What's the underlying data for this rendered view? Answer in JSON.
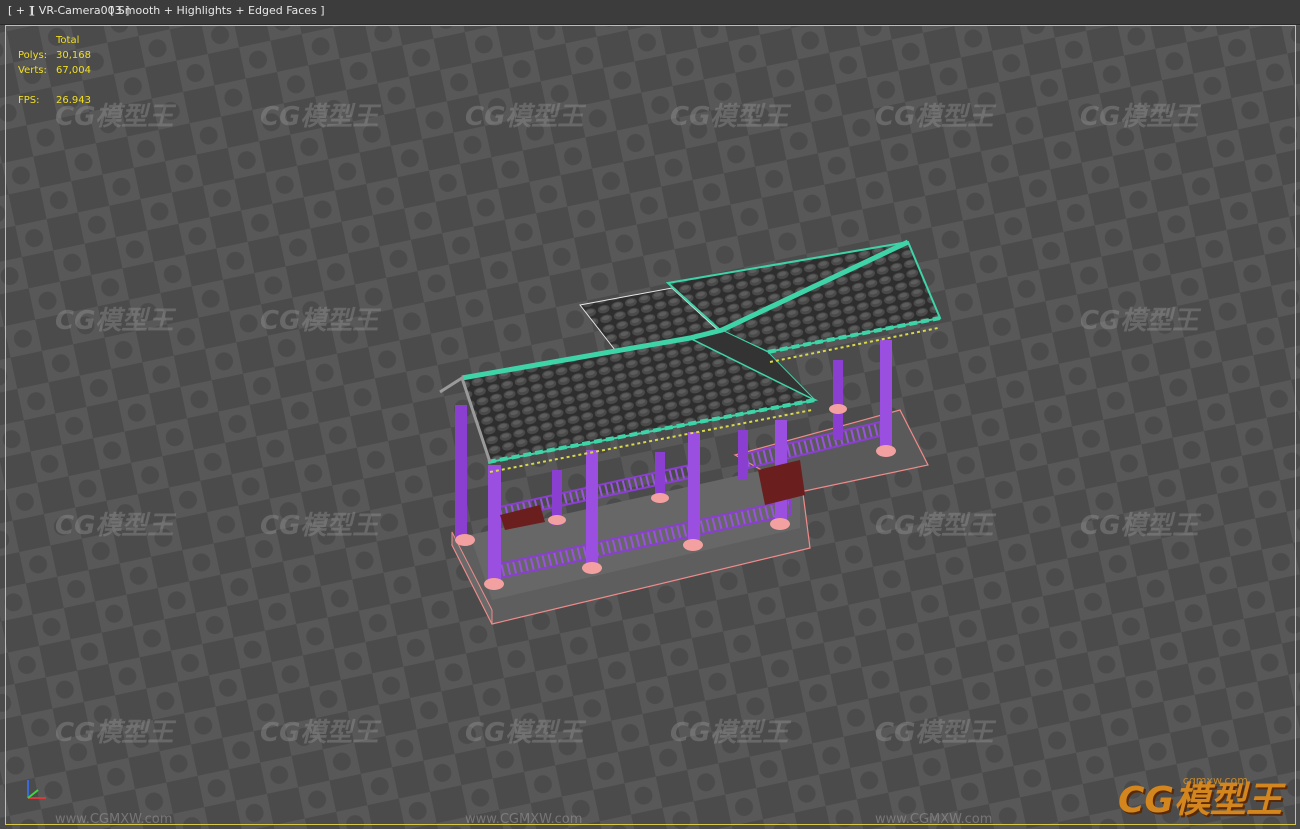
{
  "viewport": {
    "label_plus": "[ + ]",
    "label_camera": "[ VR-Camera003 ]",
    "label_shading": "[ Smooth + Highlights + Edged Faces ]"
  },
  "stats": {
    "total_label": "Total",
    "polys_label": "Polys:",
    "polys_value": "30,168",
    "verts_label": "Verts:",
    "verts_value": "67,004",
    "fps_label": "FPS:",
    "fps_value": "26.943"
  },
  "watermark": {
    "logo_text": "CG模型王",
    "site_text": "www.CGMXW.com"
  },
  "brand": {
    "logo_text": "CG模型王",
    "url": "cgmxw.com"
  },
  "colors": {
    "frame": "#d7c64a",
    "stats_text": "#f2df24",
    "columns": "#8a3fd1",
    "roof_trim": "#3fd3a8",
    "base_edge": "#f08a8a",
    "roof_tiles": "#3a3a3a"
  }
}
